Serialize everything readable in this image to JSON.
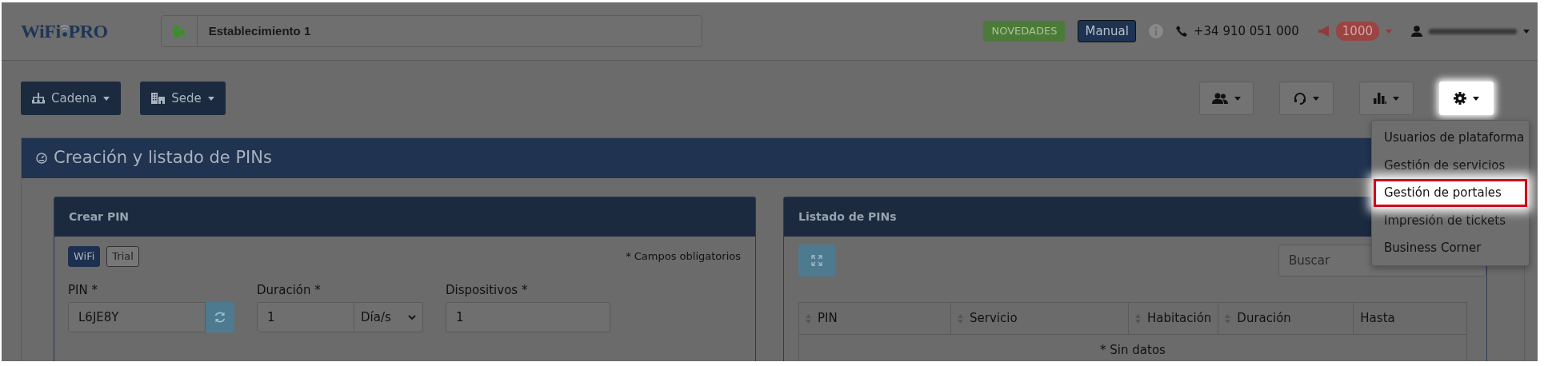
{
  "header": {
    "logo": [
      "WiFi",
      "PRO"
    ],
    "establishment": "Establecimiento 1",
    "news_button": "NOVEDADES",
    "manual_button": "Manual",
    "phone": "+34 910 051 000",
    "alerts_count": "1000"
  },
  "toolbar": {
    "left": [
      {
        "kind": "chain",
        "label": "Cadena"
      },
      {
        "kind": "site",
        "label": "Sede"
      }
    ],
    "right": [
      {
        "kind": "users",
        "open": false
      },
      {
        "kind": "support",
        "open": false
      },
      {
        "kind": "stats",
        "open": false
      },
      {
        "kind": "settings",
        "open": true
      }
    ]
  },
  "settings_menu": [
    {
      "label": "Usuarios de plataforma",
      "selected": false
    },
    {
      "label": "Gestión de servicios",
      "selected": false
    },
    {
      "label": "Gestión de portales",
      "selected": true
    },
    {
      "label": "Impresión de tickets",
      "selected": false
    },
    {
      "label": "Business Corner",
      "selected": false
    }
  ],
  "section_title": "Creación y listado de PINs",
  "create_card": {
    "title": "Crear PIN",
    "types": [
      {
        "label": "WiFi",
        "selected": true
      },
      {
        "label": "Trial",
        "selected": false
      }
    ],
    "required_note": "* Campos obligatorios",
    "fields": [
      {
        "kind": "pin",
        "label": "PIN *",
        "value": "L6JE8Y"
      },
      {
        "kind": "duration",
        "label": "Duración *",
        "value": "1",
        "unit": "Día/s"
      },
      {
        "kind": "text",
        "label": "Dispositivos *",
        "value": "1"
      }
    ]
  },
  "list_card": {
    "title": "Listado de PINs",
    "search": {
      "placeholder": "Buscar"
    },
    "columns": [
      {
        "label": "PIN",
        "sortable": true
      },
      {
        "label": "Servicio",
        "sortable": true
      },
      {
        "label": "Habitación",
        "sortable": true
      },
      {
        "label": "Duración",
        "sortable": true
      },
      {
        "label": "Hasta",
        "sortable": false
      }
    ],
    "empty_text": "* Sin datos"
  }
}
